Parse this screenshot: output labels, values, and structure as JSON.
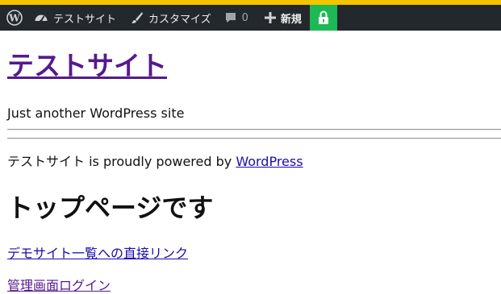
{
  "admin_bar": {
    "site_name": "テストサイト",
    "customize": "カスタマイズ",
    "comments_count": "0",
    "new_label": "新規",
    "colors": {
      "background": "#23282d",
      "top_strip": "#f5c400",
      "lock_bg": "#1db954"
    }
  },
  "site": {
    "title": "テストサイト",
    "tagline": "Just another WordPress site"
  },
  "footer": {
    "prefix": "テストサイト is proudly powered by ",
    "link_text": "WordPress"
  },
  "content": {
    "heading": "トップページです",
    "links": [
      "デモサイト一覧への直接リンク",
      "管理画面ログイン"
    ]
  },
  "icons": [
    "wordpress-logo-icon",
    "dashboard-icon",
    "brush-icon",
    "comment-icon",
    "plus-icon",
    "lock-icon"
  ]
}
